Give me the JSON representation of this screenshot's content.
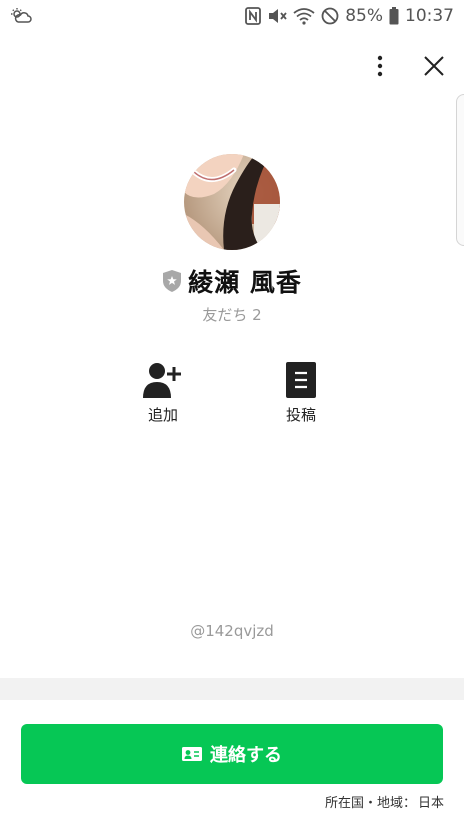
{
  "status_bar": {
    "left_icon": "weather-cloud-sun-icon",
    "icons": [
      "nfc-icon",
      "mute-icon",
      "wifi-icon",
      "do-not-disturb-icon",
      "battery-icon"
    ],
    "battery": "85%",
    "time": "10:37"
  },
  "header": {
    "more_icon": "more-vertical-icon",
    "close_icon": "close-icon"
  },
  "profile": {
    "name": "綾瀬 風香",
    "badge_icon": "official-shield-star-icon",
    "friends": "友だち 2",
    "line_id": "@142qvjzd"
  },
  "actions": [
    {
      "icon": "add-friend-icon",
      "label": "追加"
    },
    {
      "icon": "post-icon",
      "label": "投稿"
    }
  ],
  "contact_button": {
    "icon": "contact-card-icon",
    "label": "連絡する"
  },
  "region": {
    "label": "所在国・地域：",
    "value": "日本"
  },
  "colors": {
    "accent": "#06c755",
    "badge": "#a8a8a8",
    "muted_text": "#9a9a9a"
  }
}
